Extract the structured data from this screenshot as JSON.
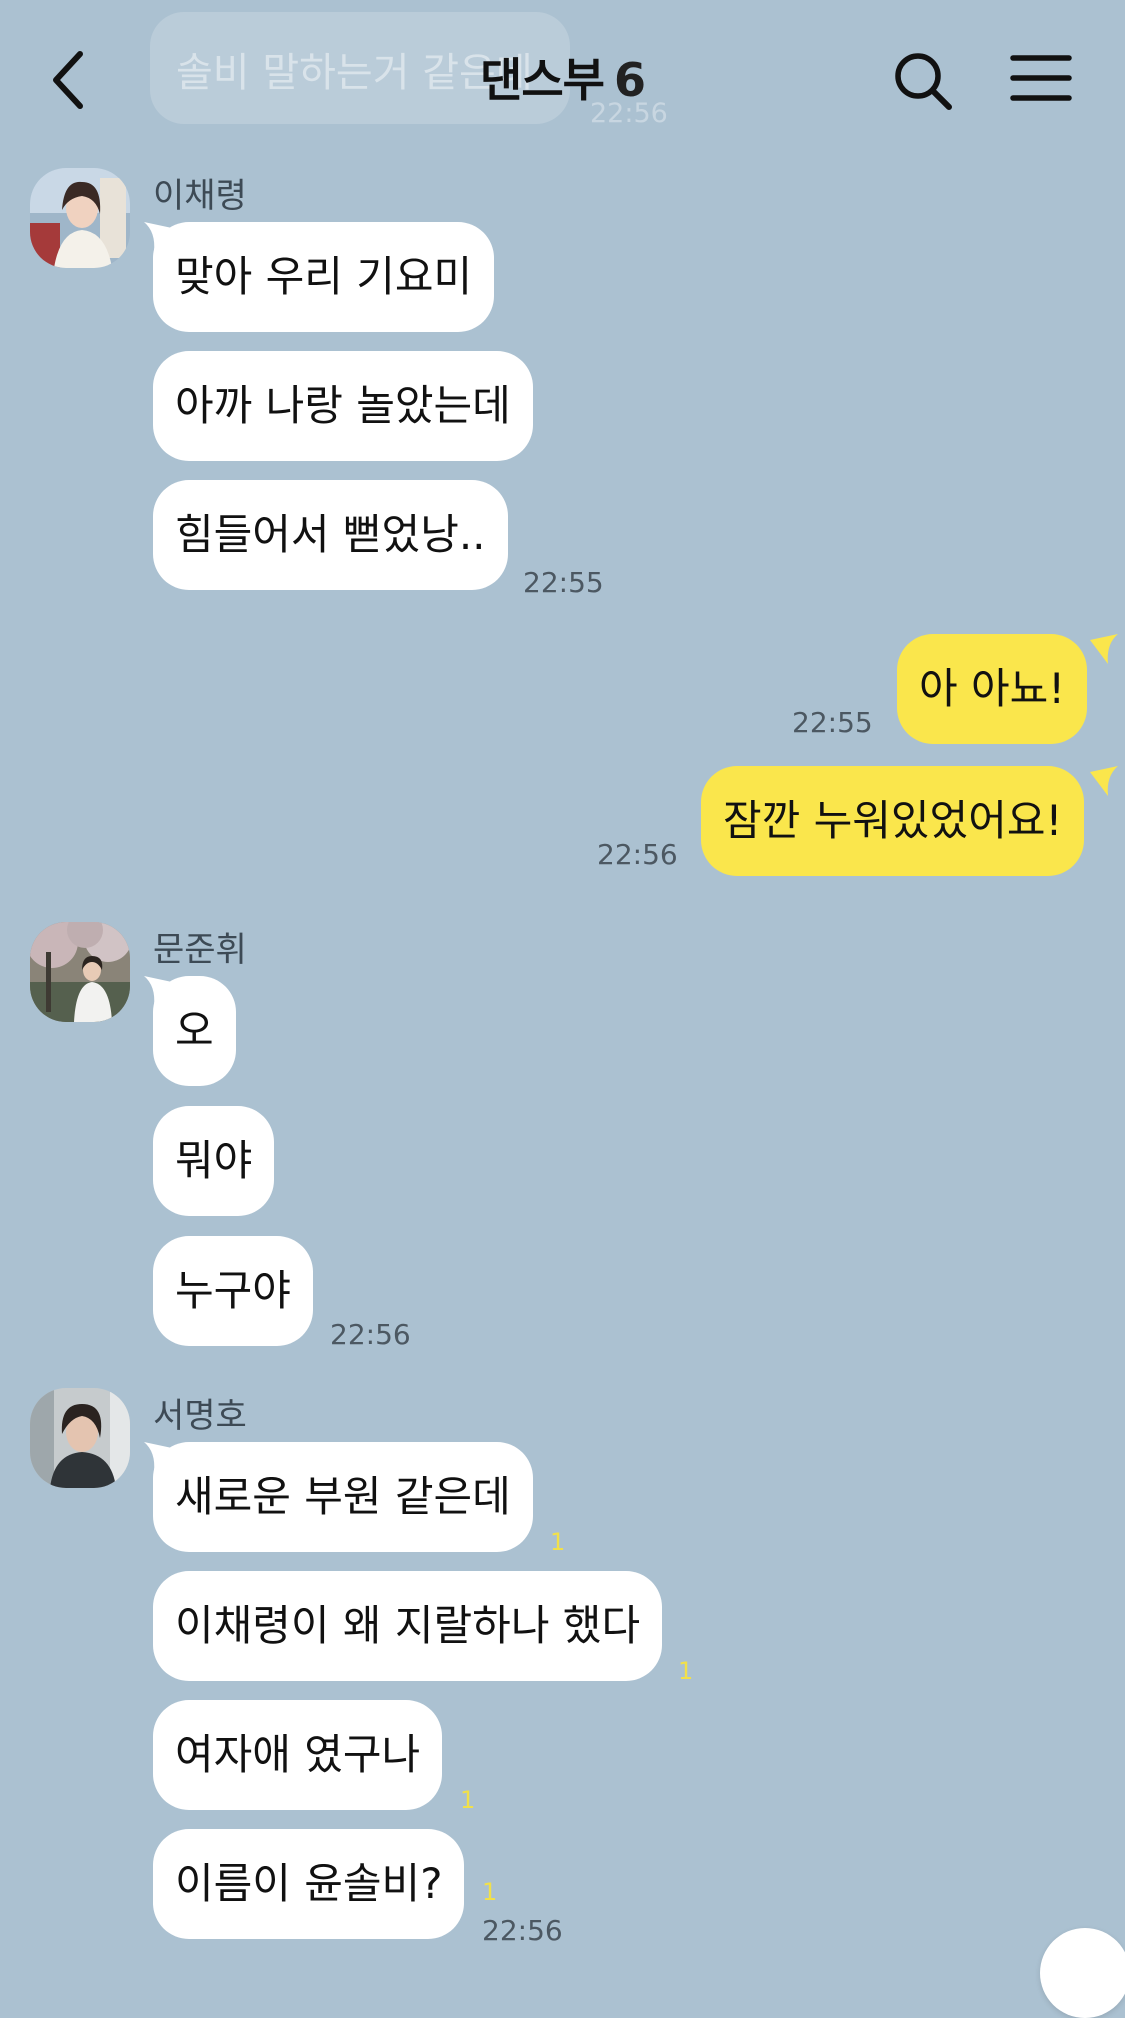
{
  "header": {
    "title": "댄스부",
    "member_count": "6",
    "back_icon": "chevron-left-icon",
    "search_icon": "search-icon",
    "menu_icon": "hamburger-menu-icon"
  },
  "preview": {
    "text": "솔비 말하는거 같은데",
    "time": "22:56"
  },
  "groups": [
    {
      "sender": "이채령",
      "messages": [
        "맞아 우리 기요미",
        "아까 나랑 놀았는데",
        "힘들어서 뻗었낭.."
      ],
      "time": "22:55"
    },
    {
      "sender": "me",
      "messages": [
        "아 아뇨!"
      ],
      "time": "22:55"
    },
    {
      "sender": "me",
      "messages": [
        "잠깐 누워있었어요!"
      ],
      "time": "22:56"
    },
    {
      "sender": "문준휘",
      "messages": [
        "오",
        "뭐야",
        "누구야"
      ],
      "time": "22:56"
    },
    {
      "sender": "서명호",
      "messages": [
        "새로운 부원 같은데",
        "이채령이 왜 지랄하나 했다",
        "여자애 였구나",
        "이름이 윤솔비?"
      ],
      "unread": [
        "1",
        "1",
        "1",
        "1"
      ],
      "time": "22:56"
    }
  ],
  "colors": {
    "background": "#abc1d1",
    "incoming_bubble": "#ffffff",
    "outgoing_bubble": "#fae64c",
    "unread_count": "#f1e04a"
  }
}
